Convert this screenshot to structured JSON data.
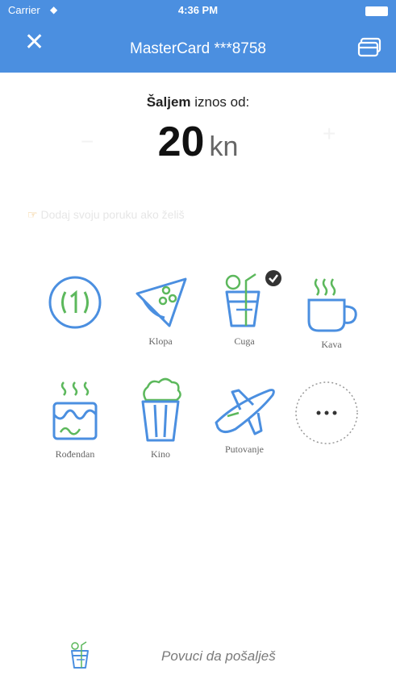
{
  "status_bar": {
    "carrier": "Carrier",
    "time": "4:36 PM"
  },
  "nav": {
    "title": "MasterCard ***8758",
    "close_icon": "close-icon",
    "cards_icon": "cards-icon"
  },
  "send": {
    "bold_label": "Šaljem",
    "label_rest": " iznos od:",
    "amount": "20",
    "currency": "kn"
  },
  "message_hint": "Dodaj svoju poruku ako želiš",
  "categories": [
    {
      "label": "",
      "icon": "coin-icon"
    },
    {
      "label": "Klopa",
      "icon": "pizza-icon"
    },
    {
      "label": "Cuga",
      "icon": "drink-icon",
      "selected": true
    },
    {
      "label": "Kava",
      "icon": "coffee-icon"
    },
    {
      "label": "Rođendan",
      "icon": "cake-icon"
    },
    {
      "label": "Kino",
      "icon": "popcorn-icon"
    },
    {
      "label": "Putovanje",
      "icon": "airplane-icon"
    },
    {
      "label": "",
      "icon": "more-icon"
    }
  ],
  "bottom": {
    "hint": "Povuci da pošalješ",
    "icon": "drink-icon"
  },
  "colors": {
    "accent": "#4b8fe0",
    "icon_blue": "#4b8fe0",
    "icon_green": "#5cb85c"
  }
}
